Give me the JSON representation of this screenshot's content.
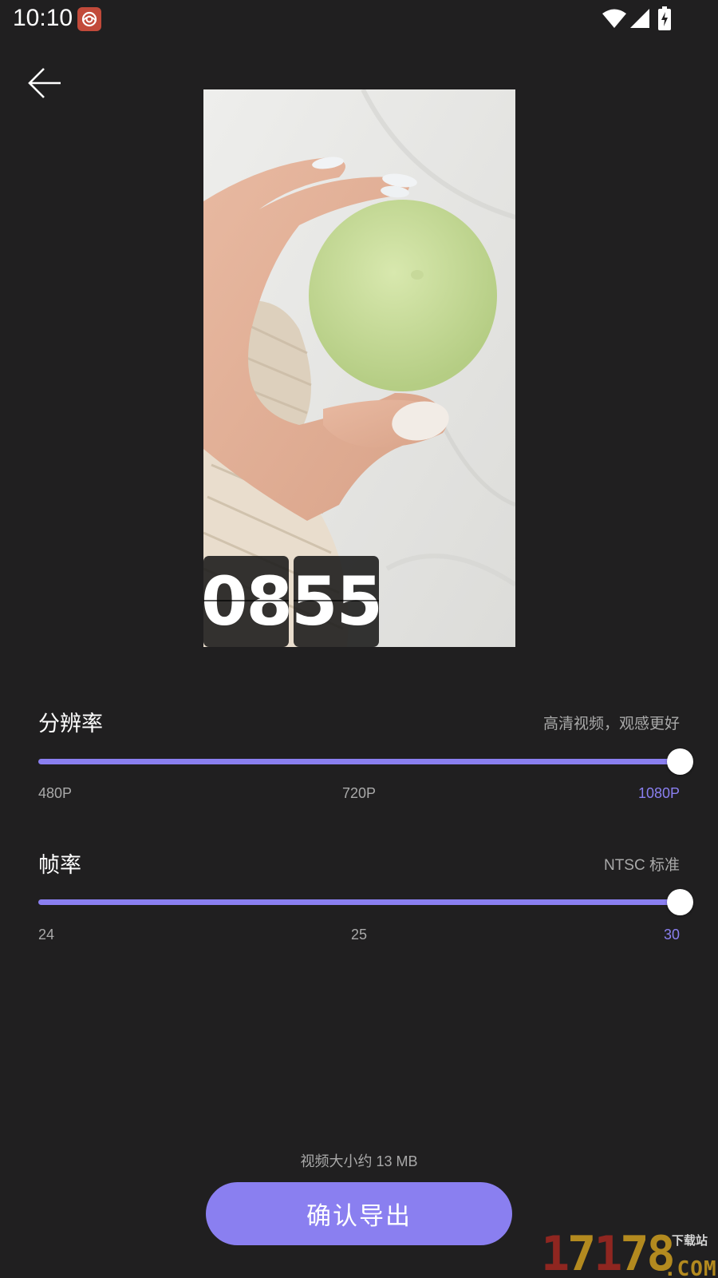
{
  "status_bar": {
    "time": "10:10",
    "icons": [
      "app-notification-icon",
      "wifi-icon",
      "signal-icon",
      "battery-charging-icon"
    ]
  },
  "toolbar": {
    "back_icon": "arrow-left-icon"
  },
  "preview": {
    "clock_digits": [
      "08",
      "55"
    ]
  },
  "resolution": {
    "title": "分辨率",
    "hint": "高清视频，观感更好",
    "options": [
      "480P",
      "720P",
      "1080P"
    ],
    "selected": "1080P",
    "selected_index": 2
  },
  "frame_rate": {
    "title": "帧率",
    "hint": "NTSC 标准",
    "options": [
      "24",
      "25",
      "30"
    ],
    "selected": "30",
    "selected_index": 2
  },
  "footer": {
    "size_info": "视频大小约 13 MB",
    "export_label": "确认导出"
  },
  "watermark": {
    "number": "17178",
    "sub": "下载站",
    "com": ".COM"
  },
  "colors": {
    "background": "#201f20",
    "accent": "#8a7ff0",
    "muted_text": "#a9a9a9",
    "text": "#ffffff"
  }
}
